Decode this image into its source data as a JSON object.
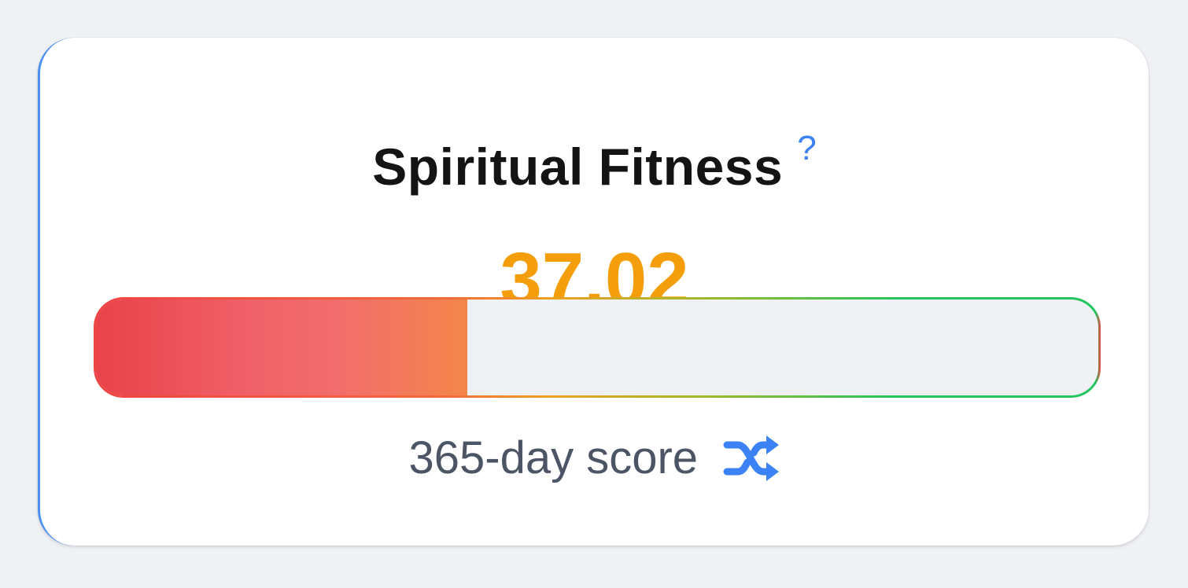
{
  "card": {
    "title": "Spiritual Fitness",
    "help_label": "?",
    "score": "37.02",
    "progress_fraction": 0.3702,
    "footer_label": "365-day score",
    "footer_icon": "shuffle-icon"
  },
  "colors": {
    "score": "#f59e0b",
    "accent": "#3b82f6",
    "bar_low": "#ef4444",
    "bar_high": "#22c55e"
  }
}
